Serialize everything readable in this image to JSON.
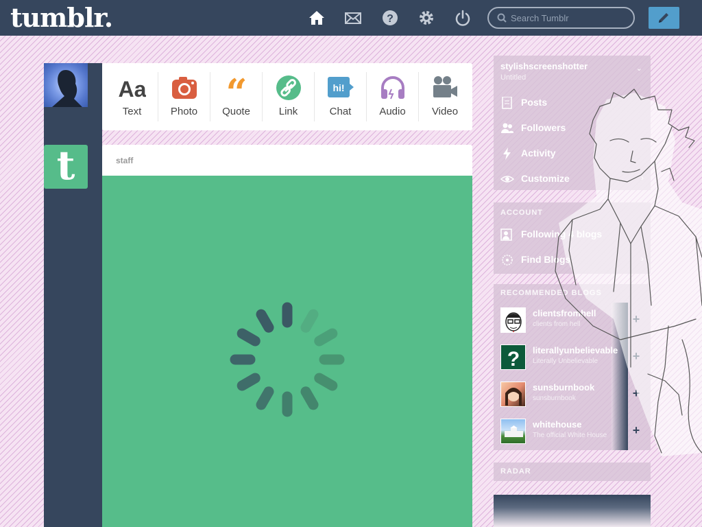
{
  "header": {
    "logo": "tumblr.",
    "search_placeholder": "Search Tumblr",
    "nav_icons": [
      "home-icon",
      "mail-icon",
      "help-icon",
      "settings-icon",
      "power-icon"
    ],
    "compose_icon": "pencil-icon"
  },
  "post_types": [
    {
      "label": "Text",
      "icon": "text-icon",
      "color": "#444444"
    },
    {
      "label": "Photo",
      "icon": "camera-icon",
      "color": "#d95e40"
    },
    {
      "label": "Quote",
      "icon": "quote-icon",
      "color": "#f2992e"
    },
    {
      "label": "Link",
      "icon": "link-icon",
      "color": "#56bc8a"
    },
    {
      "label": "Chat",
      "icon": "chat-icon",
      "color": "#529ecc"
    },
    {
      "label": "Audio",
      "icon": "headphones-icon",
      "color": "#a77dc2"
    },
    {
      "label": "Video",
      "icon": "video-camera-icon",
      "color": "#748089"
    }
  ],
  "post": {
    "author": "staff",
    "background": "#56bd8a"
  },
  "sidebar": {
    "blog": {
      "name": "stylishscreenshotter",
      "subtitle": "Untitled",
      "items": [
        {
          "label": "Posts",
          "icon": "document-icon"
        },
        {
          "label": "Followers",
          "icon": "followers-icon"
        },
        {
          "label": "Activity",
          "icon": "lightning-icon"
        },
        {
          "label": "Customize",
          "icon": "eye-icon"
        }
      ]
    },
    "account": {
      "header": "ACCOUNT",
      "items": [
        {
          "label": "Following 4 blogs",
          "icon": "following-icon"
        },
        {
          "label": "Find Blogs",
          "icon": "compass-icon"
        }
      ]
    },
    "recommended": {
      "header": "RECOMMENDED BLOGS",
      "items": [
        {
          "name": "clientsfromhell",
          "desc": "clients from hell"
        },
        {
          "name": "literallyunbelievable",
          "desc": "Literally Unbelievable"
        },
        {
          "name": "sunsburnbook",
          "desc": "sunsburnbook"
        },
        {
          "name": "whitehouse",
          "desc": "The official White House"
        }
      ]
    },
    "radar": {
      "header": "RADAR"
    }
  },
  "colors": {
    "header_bg": "#36465d",
    "compose_bg": "#529ecc",
    "page_bg": "#f6e3f3"
  }
}
